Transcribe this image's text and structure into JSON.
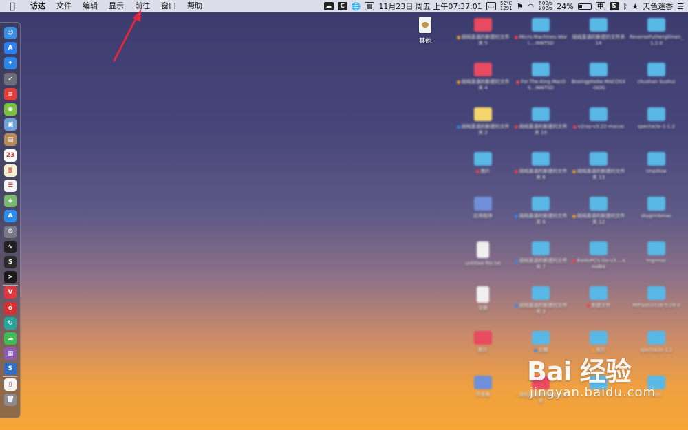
{
  "menubar": {
    "app_name": "访达",
    "menus": [
      "文件",
      "编辑",
      "显示",
      "前往",
      "窗口",
      "帮助"
    ],
    "tray": {
      "temp": "52°C",
      "fan": "1291",
      "net_up": "0B/s",
      "net_down": "0B/s",
      "datetime": "11月23日 周五 上午07:37:01",
      "battery": "24%",
      "input_method": "中",
      "user": "天色迷香"
    }
  },
  "desktop": {
    "file_label": "其他"
  },
  "icons": [
    {
      "label": "阅纯直语的新建的文件夹 5",
      "type": "red",
      "dot": "#f0a030"
    },
    {
      "label": "Micro.Machines.Worl....INNTSD",
      "type": "folder",
      "dot": "#e44"
    },
    {
      "label": "阅纯直语的新建的文件夹 14",
      "type": "folder",
      "dot": ""
    },
    {
      "label": "ReverseFuthergltinen_1.2.0",
      "type": "folder",
      "dot": ""
    },
    {
      "label": "阅纯直语的新建的文件夹 4",
      "type": "red",
      "dot": "#f0a030"
    },
    {
      "label": "For.The.King.MacOS...INNTSD",
      "type": "folder",
      "dot": "#e44"
    },
    {
      "label": "Boxingphobe.MACOSX-GOG",
      "type": "folder",
      "dot": ""
    },
    {
      "label": "chushan Sushui",
      "type": "folder",
      "dot": ""
    },
    {
      "label": "阅纯直语的新建的文件夹 2",
      "type": "yellow",
      "dot": "#38e"
    },
    {
      "label": "阅纯直语的新建的文件夹 10",
      "type": "folder",
      "dot": "#e44"
    },
    {
      "label": "v2ray-v3.22-macos",
      "type": "folder",
      "dot": "#e44"
    },
    {
      "label": "spectacle-1-1.2",
      "type": "folder",
      "dot": ""
    },
    {
      "label": "图片",
      "type": "folder",
      "dot": "#e44"
    },
    {
      "label": "阅纯直语的新建的文件夹 6",
      "type": "folder",
      "dot": "#e44"
    },
    {
      "label": "阅纯直语的新建的文件夹 13",
      "type": "folder",
      "dot": "#f0a030"
    },
    {
      "label": "Unpillow",
      "type": "folder",
      "dot": ""
    },
    {
      "label": "应用程序",
      "type": "misc",
      "dot": ""
    },
    {
      "label": "阅纯直语的新建的文件夹 8",
      "type": "folder",
      "dot": "#38e"
    },
    {
      "label": "阅纯直语的新建的文件夹 12",
      "type": "folder",
      "dot": "#f0a030"
    },
    {
      "label": "skygrmbmac",
      "type": "folder",
      "dot": ""
    },
    {
      "label": "untitled file.txt",
      "type": "doc",
      "dot": ""
    },
    {
      "label": "阅纯直语的新建的文件夹 7",
      "type": "folder",
      "dot": "#38e"
    },
    {
      "label": "BaiduPCS-Go-v3....amd64",
      "type": "folder",
      "dot": "#e44"
    },
    {
      "label": "tngrmac",
      "type": "folder",
      "dot": ""
    },
    {
      "label": "交换",
      "type": "doc",
      "dot": ""
    },
    {
      "label": "阅纯直语的新建的文件夹 3",
      "type": "folder",
      "dot": "#38e"
    },
    {
      "label": "新建文件",
      "type": "folder",
      "dot": "#e44"
    },
    {
      "label": "MiFlash2018-5-28-0",
      "type": "folder",
      "dot": ""
    },
    {
      "label": "影片",
      "type": "red",
      "dot": ""
    },
    {
      "label": "文稿",
      "type": "folder",
      "dot": "#38e"
    },
    {
      "label": "照片",
      "type": "folder",
      "dot": "#f0a030"
    },
    {
      "label": "spectacle-1.2",
      "type": "folder",
      "dot": ""
    },
    {
      "label": "开发者",
      "type": "misc",
      "dot": ""
    },
    {
      "label": "阅纯直语的新建的文件夹",
      "type": "red",
      "dot": "#f0a030"
    },
    {
      "label": "",
      "type": "folder",
      "dot": ""
    },
    {
      "label": "Icon",
      "type": "folder",
      "dot": ""
    }
  ],
  "dock": [
    {
      "name": "finder",
      "color": "#3a8ee6",
      "glyph": "☺"
    },
    {
      "name": "appstore",
      "color": "#2d7ef0",
      "glyph": "A"
    },
    {
      "name": "safari",
      "color": "#2c86e8",
      "glyph": "✦"
    },
    {
      "name": "launchpad",
      "color": "#6e6e7a",
      "glyph": "➶"
    },
    {
      "name": "ticktick",
      "color": "#e43b3b",
      "glyph": "≡"
    },
    {
      "name": "android",
      "color": "#7ac142",
      "glyph": "◉"
    },
    {
      "name": "preview",
      "color": "#6fa0d8",
      "glyph": "▣"
    },
    {
      "name": "contacts",
      "color": "#b8895a",
      "glyph": "▤"
    },
    {
      "name": "calendar",
      "color": "#ffffff",
      "glyph": "23"
    },
    {
      "name": "notes",
      "color": "#f5f0d0",
      "glyph": "≣"
    },
    {
      "name": "reminders",
      "color": "#f4f4f4",
      "glyph": "☰"
    },
    {
      "name": "maps",
      "color": "#7ab870",
      "glyph": "◈"
    },
    {
      "name": "appstore2",
      "color": "#2b8cf0",
      "glyph": "A"
    },
    {
      "name": "system-preferences",
      "color": "#7a7a86",
      "glyph": "⚙"
    },
    {
      "name": "activity-monitor",
      "color": "#222222",
      "glyph": "∿"
    },
    {
      "name": "terminal",
      "color": "#2a2a2a",
      "glyph": "$"
    },
    {
      "name": "terminal2",
      "color": "#1a1a1a",
      "glyph": ">"
    },
    {
      "name": "vivaldi",
      "color": "#e0383e",
      "glyph": "V"
    },
    {
      "name": "netease-music",
      "color": "#d83030",
      "glyph": "ó"
    },
    {
      "name": "sync",
      "color": "#26a69a",
      "glyph": "↻"
    },
    {
      "name": "wechat",
      "color": "#3dbc54",
      "glyph": "☁"
    },
    {
      "name": "winrar",
      "color": "#8a5cb8",
      "glyph": "▦"
    },
    {
      "name": "scrivener",
      "color": "#2f6fc8",
      "glyph": "S"
    },
    {
      "name": "document",
      "color": "#f4f4f4",
      "glyph": "▯"
    },
    {
      "name": "trash",
      "color": "#8a8a90",
      "glyph": "🗑"
    }
  ],
  "watermark": {
    "brand": "Bai 经验",
    "url": "jingyan.baidu.com"
  }
}
